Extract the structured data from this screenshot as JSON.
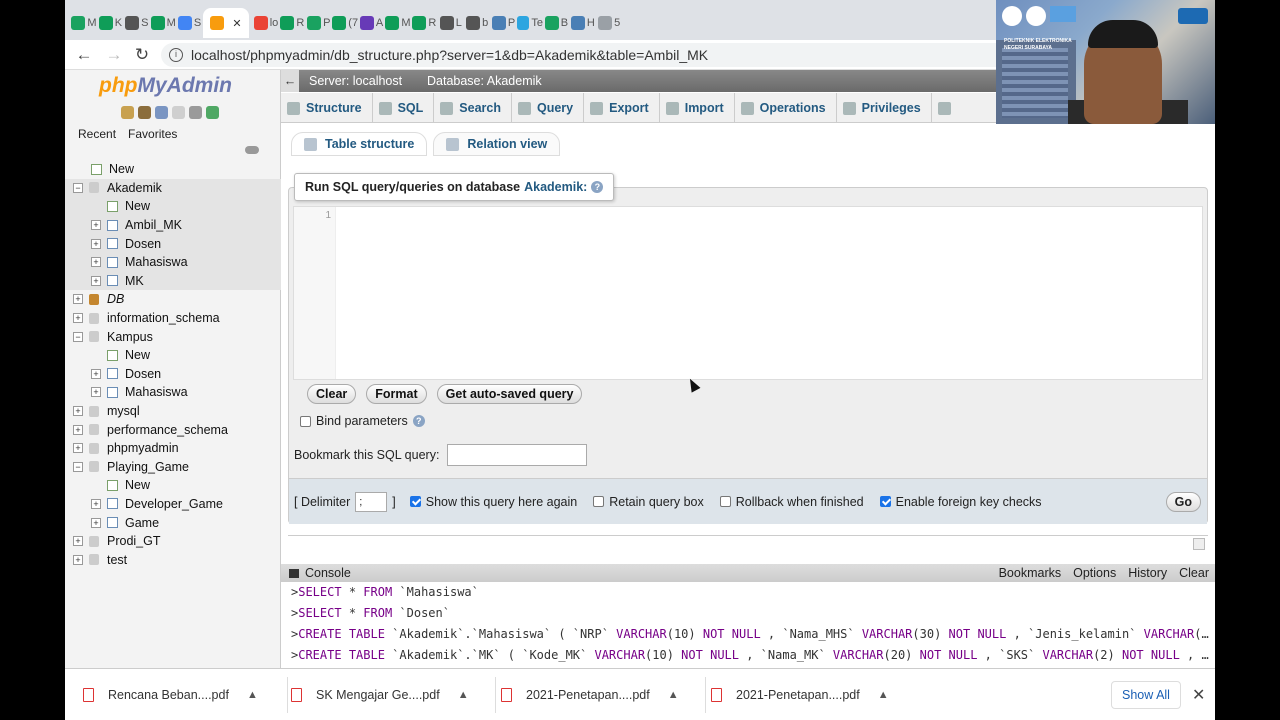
{
  "browser": {
    "tabs": [
      {
        "label": "M",
        "color": "#1aa260"
      },
      {
        "label": "K",
        "color": "#0f9d58"
      },
      {
        "label": "S",
        "color": "#555555"
      },
      {
        "label": "M",
        "color": "#0f9d58"
      },
      {
        "label": "S",
        "color": "#4285f4"
      },
      {
        "label": "",
        "color": "#f89c0e",
        "active": true
      },
      {
        "label": "lo",
        "color": "#ea4335"
      },
      {
        "label": "R",
        "color": "#0f9d58"
      },
      {
        "label": "P",
        "color": "#1aa260"
      },
      {
        "label": "(7",
        "color": "#0f9d58"
      },
      {
        "label": "A",
        "color": "#673ab7"
      },
      {
        "label": "M",
        "color": "#0f9d58"
      },
      {
        "label": "R",
        "color": "#0f9d58"
      },
      {
        "label": "L",
        "color": "#555555"
      },
      {
        "label": "b",
        "color": "#555555"
      },
      {
        "label": "P",
        "color": "#4a7fb5"
      },
      {
        "label": "Te",
        "color": "#2ca5e0"
      },
      {
        "label": "B",
        "color": "#1aa260"
      },
      {
        "label": "H",
        "color": "#4a7fb5"
      },
      {
        "label": "5",
        "color": "#9aa0a6"
      }
    ],
    "url": "localhost/phpmyadmin/db_structure.php?server=1&db=Akademik&table=Ambil_MK"
  },
  "sidebar": {
    "logo_php": "php",
    "logo_my": "MyAdmin",
    "recent_label": "Recent",
    "favorites_label": "Favorites",
    "tree": [
      {
        "label": "New",
        "level": 0,
        "type": "new"
      },
      {
        "label": "Akademik",
        "level": 0,
        "type": "db",
        "expanded": true,
        "selected": true
      },
      {
        "label": "New",
        "level": 1,
        "type": "new",
        "selected": true
      },
      {
        "label": "Ambil_MK",
        "level": 1,
        "type": "table",
        "selected": true
      },
      {
        "label": "Dosen",
        "level": 1,
        "type": "table",
        "selected": true
      },
      {
        "label": "Mahasiswa",
        "level": 1,
        "type": "table",
        "selected": true
      },
      {
        "label": "MK",
        "level": 1,
        "type": "table",
        "selected": true
      },
      {
        "label": "DB",
        "level": 0,
        "type": "group",
        "italic": true
      },
      {
        "label": "information_schema",
        "level": 0,
        "type": "db"
      },
      {
        "label": "Kampus",
        "level": 0,
        "type": "db",
        "expanded": true
      },
      {
        "label": "New",
        "level": 1,
        "type": "new"
      },
      {
        "label": "Dosen",
        "level": 1,
        "type": "table"
      },
      {
        "label": "Mahasiswa",
        "level": 1,
        "type": "table"
      },
      {
        "label": "mysql",
        "level": 0,
        "type": "db"
      },
      {
        "label": "performance_schema",
        "level": 0,
        "type": "db"
      },
      {
        "label": "phpmyadmin",
        "level": 0,
        "type": "db"
      },
      {
        "label": "Playing_Game",
        "level": 0,
        "type": "db",
        "expanded": true
      },
      {
        "label": "New",
        "level": 1,
        "type": "new"
      },
      {
        "label": "Developer_Game",
        "level": 1,
        "type": "table"
      },
      {
        "label": "Game",
        "level": 1,
        "type": "table"
      },
      {
        "label": "Prodi_GT",
        "level": 0,
        "type": "db"
      },
      {
        "label": "test",
        "level": 0,
        "type": "db"
      }
    ]
  },
  "breadcrumb": {
    "server": "Server: localhost",
    "sep": "»",
    "database": "Database: Akademik"
  },
  "menu": [
    "Structure",
    "SQL",
    "Search",
    "Query",
    "Export",
    "Import",
    "Operations",
    "Privileges"
  ],
  "subtabs": [
    "Table structure",
    "Relation view"
  ],
  "sqlpanel": {
    "legend_prefix": "Run SQL query/queries on database",
    "db_name": "Akademik:",
    "line_number": "1",
    "buttons": [
      "Clear",
      "Format",
      "Get auto-saved query"
    ],
    "bind_label": "Bind parameters",
    "bookmark_label": "Bookmark this SQL query:",
    "delimiter_label": "[ Delimiter",
    "delimiter_value": ";",
    "delimiter_close": "]",
    "options": [
      {
        "label": "Show this query here again",
        "checked": true
      },
      {
        "label": "Retain query box",
        "checked": false
      },
      {
        "label": "Rollback when finished",
        "checked": false
      },
      {
        "label": "Enable foreign key checks",
        "checked": true
      }
    ],
    "go_label": "Go"
  },
  "console": {
    "title": "Console",
    "links": [
      "Bookmarks",
      "Options",
      "History",
      "Clear"
    ],
    "lines": [
      ">SELECT * FROM `Mahasiswa`",
      ">SELECT * FROM `Dosen`",
      ">CREATE TABLE `Akademik`.`Mahasiswa` ( `NRP` VARCHAR(10) NOT NULL , `Nama_MHS` VARCHAR(30) NOT NULL , `Jenis_kelamin` VARCHAR(10...",
      ">CREATE TABLE `Akademik`.`MK` ( `Kode_MK` VARCHAR(10) NOT NULL , `Nama_MK` VARCHAR(20) NOT NULL , `SKS` VARCHAR(2) NOT NULL , `S..."
    ]
  },
  "downloads": {
    "items": [
      "Rencana Beban....pdf",
      "SK Mengajar Ge....pdf",
      "2021-Penetapan....pdf",
      "2021-Penetapan....pdf"
    ],
    "show_all": "Show All"
  },
  "webcam": {
    "caption": "POLITEKNIK ELEKTRONIKA NEGERI SURABAYA"
  }
}
